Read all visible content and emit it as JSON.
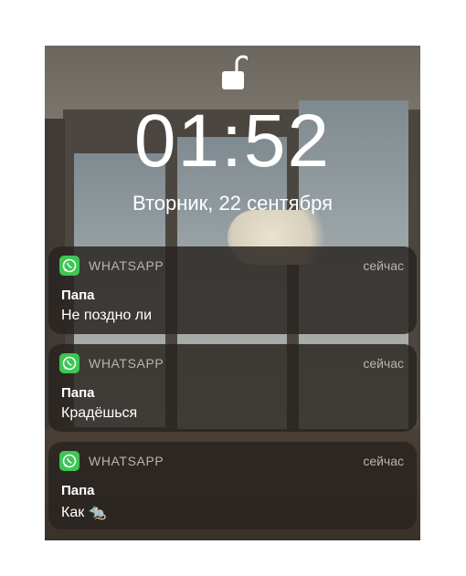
{
  "lockscreen": {
    "time": "01:52",
    "date": "Вторник, 22 сентября"
  },
  "notifications": [
    {
      "app": "WHATSAPP",
      "time": "сейчас",
      "sender": "Папа",
      "message": "Не поздно ли",
      "icon": "whatsapp-icon"
    },
    {
      "app": "WHATSAPP",
      "time": "сейчас",
      "sender": "Папа",
      "message": "Крадёшься",
      "icon": "whatsapp-icon"
    },
    {
      "app": "WHATSAPP",
      "time": "сейчас",
      "sender": "Папа",
      "message": "Как 🐀",
      "icon": "whatsapp-icon"
    }
  ],
  "colors": {
    "accent": "#3dc653",
    "card": "#28241f"
  }
}
